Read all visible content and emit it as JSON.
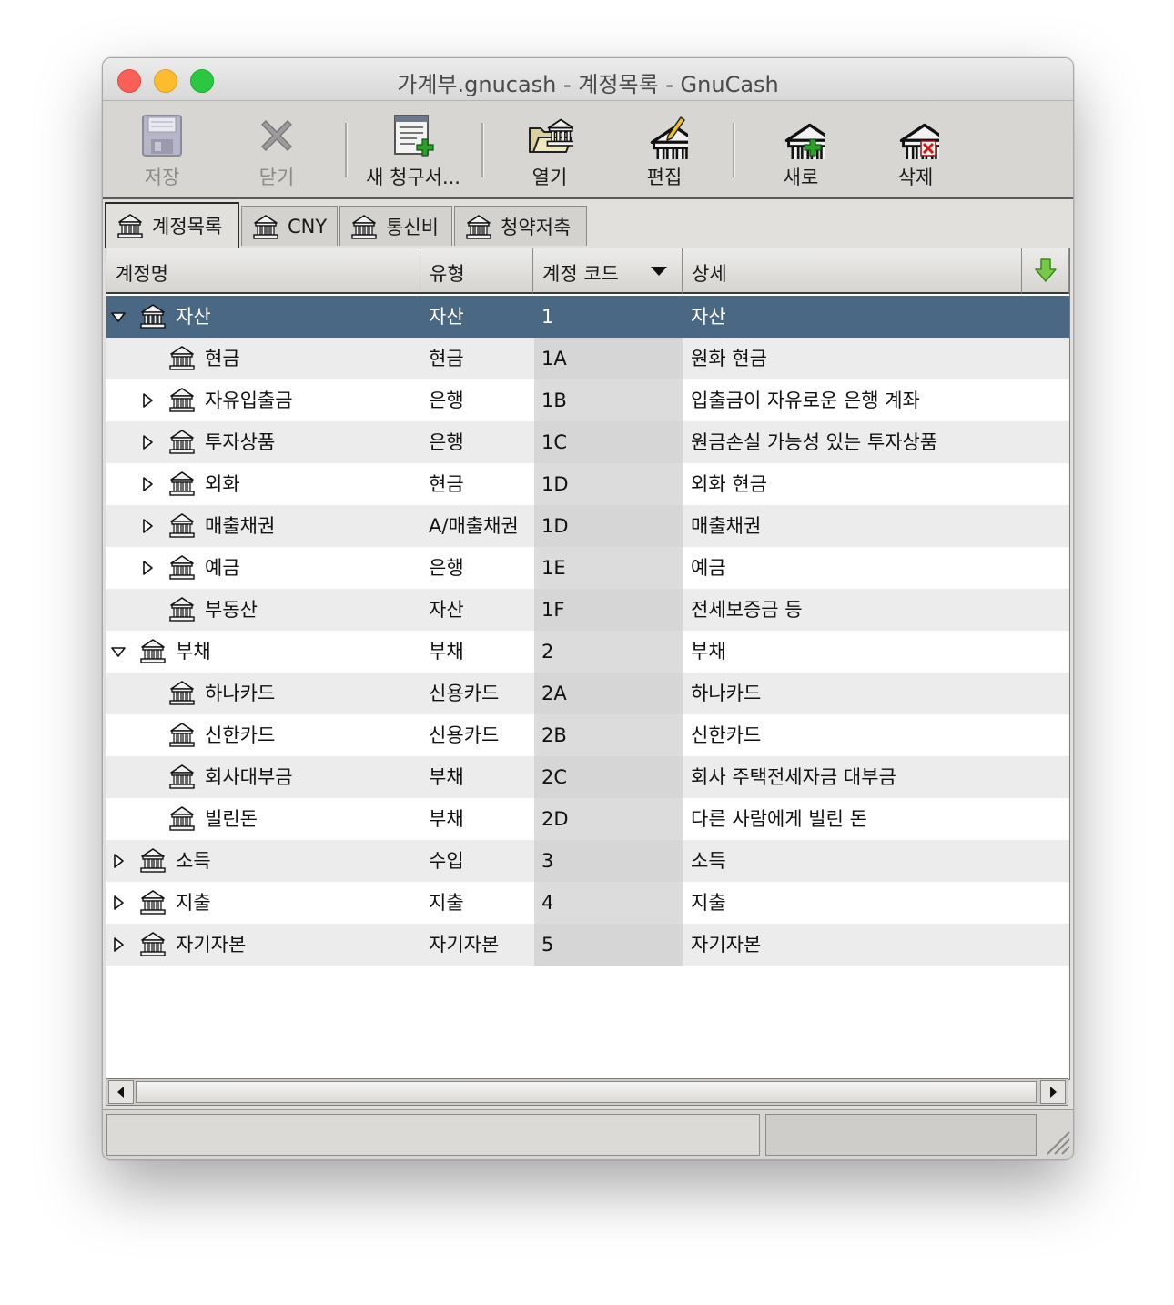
{
  "window": {
    "title": "가계부.gnucash - 계정목록 - GnuCash"
  },
  "toolbar": {
    "save": "저장",
    "close": "닫기",
    "new_invoice": "새 청구서...",
    "open": "열기",
    "edit": "편집",
    "new": "새로",
    "delete": "삭제"
  },
  "tabs": [
    {
      "label": "계정목록"
    },
    {
      "label": "CNY"
    },
    {
      "label": "통신비"
    },
    {
      "label": "청약저축"
    }
  ],
  "columns": {
    "name": "계정명",
    "type": "유형",
    "code": "계정 코드",
    "description": "상세"
  },
  "accounts": [
    {
      "name": "자산",
      "type": "자산",
      "code": "1",
      "description": "자산"
    },
    {
      "name": "현금",
      "type": "현금",
      "code": "1A",
      "description": "원화 현금"
    },
    {
      "name": "자유입출금",
      "type": "은행",
      "code": "1B",
      "description": "입출금이 자유로운 은행 계좌"
    },
    {
      "name": "투자상품",
      "type": "은행",
      "code": "1C",
      "description": "원금손실 가능성 있는 투자상품"
    },
    {
      "name": "외화",
      "type": "현금",
      "code": "1D",
      "description": "외화 현금"
    },
    {
      "name": "매출채권",
      "type": "A/매출채권",
      "code": "1D",
      "description": "매출채권"
    },
    {
      "name": "예금",
      "type": "은행",
      "code": "1E",
      "description": "예금"
    },
    {
      "name": "부동산",
      "type": "자산",
      "code": "1F",
      "description": "전세보증금 등"
    },
    {
      "name": "부채",
      "type": "부채",
      "code": "2",
      "description": "부채"
    },
    {
      "name": "하나카드",
      "type": "신용카드",
      "code": "2A",
      "description": "하나카드"
    },
    {
      "name": "신한카드",
      "type": "신용카드",
      "code": "2B",
      "description": "신한카드"
    },
    {
      "name": "회사대부금",
      "type": "부채",
      "code": "2C",
      "description": "회사 주택전세자금 대부금"
    },
    {
      "name": "빌린돈",
      "type": "부채",
      "code": "2D",
      "description": "다른 사람에게 빌린 돈"
    },
    {
      "name": "소득",
      "type": "수입",
      "code": "3",
      "description": "소득"
    },
    {
      "name": "지출",
      "type": "지출",
      "code": "4",
      "description": "지출"
    },
    {
      "name": "자기자본",
      "type": "자기자본",
      "code": "5",
      "description": "자기자본"
    }
  ]
}
